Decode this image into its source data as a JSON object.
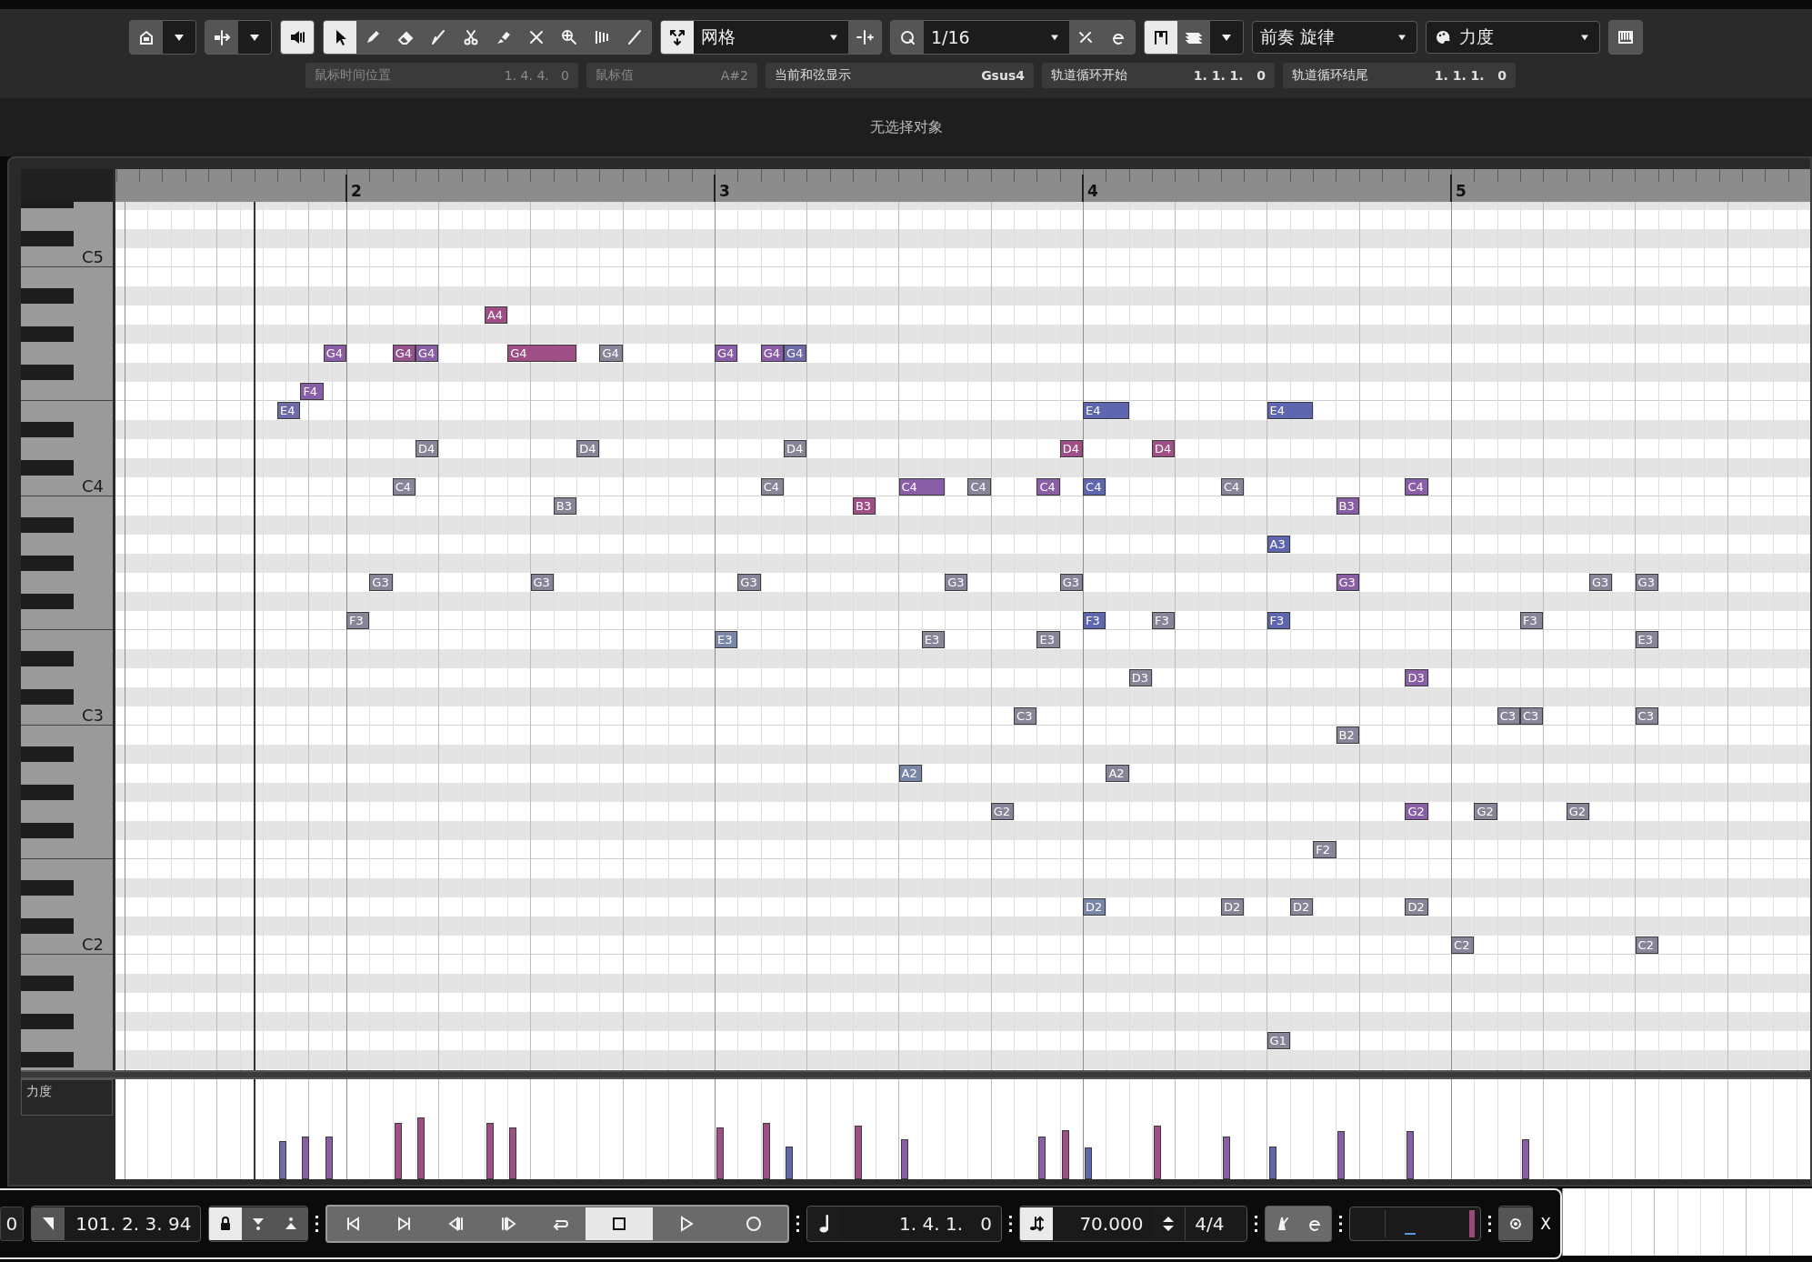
{
  "toolbar": {
    "audio_feedback": {
      "on": true
    },
    "tools": [
      {
        "selected": true
      },
      {
        "selected": false
      },
      {
        "selected": false
      },
      {
        "selected": false
      },
      {
        "selected": false
      },
      {
        "selected": false
      },
      {
        "selected": false
      },
      {
        "selected": false
      },
      {
        "selected": false
      },
      {
        "selected": false
      }
    ],
    "snap": {
      "on": true,
      "mode": "网格"
    },
    "quantize": {
      "value": "1/16"
    },
    "edit_toggle": {
      "on": true
    },
    "track": "前奏 旋律",
    "controller": "力度"
  },
  "info": [
    {
      "label": "鼠标时间位置",
      "value": "1. 4. 4.   0"
    },
    {
      "label": "鼠标值",
      "value": "A#2"
    },
    {
      "label": "当前和弦显示",
      "value": "Gsus4"
    },
    {
      "label": "轨道循环开始",
      "value": "1. 1. 1.   0"
    },
    {
      "label": "轨道循环结尾",
      "value": "1. 1. 1.   0"
    }
  ],
  "status": "无选择对象",
  "ruler": {
    "bars": [
      "2",
      "3",
      "4",
      "5"
    ]
  },
  "keyboard": {
    "labels": [
      "C5",
      "C4",
      "C3",
      "C2"
    ]
  },
  "notes": [
    {
      "label": "A4",
      "color": "#a04f86"
    },
    {
      "label": "G4",
      "color": "#8a5ea6"
    },
    {
      "label": "G4",
      "color": "#94528e"
    },
    {
      "label": "G4",
      "color": "#8a5ea6"
    },
    {
      "label": "G4",
      "color": "#a04f86"
    },
    {
      "label": "G4",
      "color": "#8a8498"
    },
    {
      "label": "G4",
      "color": "#8a5ea6"
    },
    {
      "label": "G4",
      "color": "#8a5ea6"
    },
    {
      "label": "G4",
      "color": "#6f6aa8"
    },
    {
      "label": "F4",
      "color": "#8a5ea6"
    },
    {
      "label": "E4",
      "color": "#6f6aa8"
    },
    {
      "label": "E4",
      "color": "#5e66b0"
    },
    {
      "label": "E4",
      "color": "#5e66b0"
    },
    {
      "label": "D4",
      "color": "#8a8498"
    },
    {
      "label": "D4",
      "color": "#8a8498"
    },
    {
      "label": "D4",
      "color": "#8a8498"
    },
    {
      "label": "D4",
      "color": "#a04f86"
    },
    {
      "label": "D4",
      "color": "#a04f86"
    },
    {
      "label": "C4",
      "color": "#8a8498"
    },
    {
      "label": "C4",
      "color": "#8a8498"
    },
    {
      "label": "C4",
      "color": "#8a5ea6"
    },
    {
      "label": "C4",
      "color": "#8a8498"
    },
    {
      "label": "C4",
      "color": "#8a5ea6"
    },
    {
      "label": "C4",
      "color": "#5e66b0"
    },
    {
      "label": "C4",
      "color": "#8a8498"
    },
    {
      "label": "C4",
      "color": "#8a5ea6"
    },
    {
      "label": "B3",
      "color": "#8a8498"
    },
    {
      "label": "B3",
      "color": "#a04f86"
    },
    {
      "label": "B3",
      "color": "#8a5ea6"
    },
    {
      "label": "A3",
      "color": "#5e66b0"
    },
    {
      "label": "G3",
      "color": "#8a8498"
    },
    {
      "label": "G3",
      "color": "#8a8498"
    },
    {
      "label": "G3",
      "color": "#8a8498"
    },
    {
      "label": "G3",
      "color": "#8a8498"
    },
    {
      "label": "G3",
      "color": "#8a8498"
    },
    {
      "label": "G3",
      "color": "#8a5ea6"
    },
    {
      "label": "G3",
      "color": "#8a8498"
    },
    {
      "label": "G3",
      "color": "#8a8498"
    },
    {
      "label": "F3",
      "color": "#8a8498"
    },
    {
      "label": "F3",
      "color": "#5e66b0"
    },
    {
      "label": "F3",
      "color": "#8a8498"
    },
    {
      "label": "F3",
      "color": "#5e66b0"
    },
    {
      "label": "F3",
      "color": "#8a8498"
    },
    {
      "label": "E3",
      "color": "#7a86a8"
    },
    {
      "label": "E3",
      "color": "#8a8498"
    },
    {
      "label": "E3",
      "color": "#8a8498"
    },
    {
      "label": "E3",
      "color": "#8a8498"
    },
    {
      "label": "D3",
      "color": "#8a8498"
    },
    {
      "label": "D3",
      "color": "#8a5ea6"
    },
    {
      "label": "C3",
      "color": "#8a8498"
    },
    {
      "label": "C3",
      "color": "#8a8498"
    },
    {
      "label": "C3",
      "color": "#8a8498"
    },
    {
      "label": "C3",
      "color": "#8a8498"
    },
    {
      "label": "B2",
      "color": "#8a8498"
    },
    {
      "label": "A2",
      "color": "#7a86a8"
    },
    {
      "label": "A2",
      "color": "#8a8498"
    },
    {
      "label": "G2",
      "color": "#8a8498"
    },
    {
      "label": "G2",
      "color": "#8a5ea6"
    },
    {
      "label": "G2",
      "color": "#8a8498"
    },
    {
      "label": "G2",
      "color": "#8a8498"
    },
    {
      "label": "F2",
      "color": "#8a8498"
    },
    {
      "label": "D2",
      "color": "#7a86a8"
    },
    {
      "label": "D2",
      "color": "#8a8498"
    },
    {
      "label": "D2",
      "color": "#8a8498"
    },
    {
      "label": "D2",
      "color": "#8a8498"
    },
    {
      "label": "C2",
      "color": "#8a8498"
    },
    {
      "label": "C2",
      "color": "#8a8498"
    },
    {
      "label": "G1",
      "color": "#8a8498"
    }
  ],
  "velocity_lane": {
    "label": "力度"
  },
  "transport": {
    "left_value": "0",
    "position": "101. 2. 3. 94",
    "lock": {
      "on": true
    },
    "buttons": [
      {
        "selected": false
      },
      {
        "selected": false
      },
      {
        "selected": false
      },
      {
        "selected": false
      },
      {
        "selected": false
      },
      {
        "selected": true
      },
      {
        "selected": false
      },
      {
        "selected": false
      }
    ],
    "time": "1. 4. 1.   0",
    "tempo": "70.000",
    "signature": "4/4",
    "close": "X"
  }
}
